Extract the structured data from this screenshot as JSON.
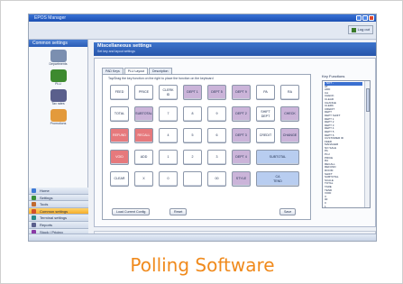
{
  "window": {
    "title": "EPOS Manager"
  },
  "header": {
    "logout_label": "Log out"
  },
  "sidebar": {
    "section_title": "Common settings",
    "icons": [
      {
        "label": "Departments",
        "icon": "cash-register-icon",
        "color": "#7b8fb0"
      },
      {
        "label": "PLU",
        "icon": "shapes-icon",
        "color": "#3d8a2f"
      },
      {
        "label": "Tax rates",
        "icon": "percent-icon",
        "color": "#5a5f8c"
      },
      {
        "label": "Promotions",
        "icon": "tag-icon",
        "color": "#e39a3b"
      }
    ],
    "nav": [
      {
        "label": "Home",
        "color": "#3f7ad6"
      },
      {
        "label": "Settings",
        "color": "#3b8f3b"
      },
      {
        "label": "Tools",
        "color": "#c06a30"
      },
      {
        "label": "Common settings",
        "color": "#d24f2a",
        "selected": true
      },
      {
        "label": "Terminal settings",
        "color": "#2a8a8a"
      },
      {
        "label": "Reports",
        "color": "#5a5f8c"
      },
      {
        "label": "Stock / Pricing",
        "color": "#8a3aa6"
      },
      {
        "label": "Exports",
        "color": "#3f7ad6"
      }
    ]
  },
  "main": {
    "title": "Miscellaneous settings",
    "subtitle": "Set key and layout settings",
    "tabs": [
      "PAD Keys",
      "PLU Layout",
      "Description"
    ],
    "active_tab": 1,
    "instruction": "Tap/Drag the key function on the right to place the function on the keyboard",
    "keys": [
      {
        "label": "FEED",
        "color": "white"
      },
      {
        "label": "PRICE",
        "color": "white"
      },
      {
        "label": "CLERK\nID",
        "color": "white"
      },
      {
        "label": "DEPT 1",
        "color": "purple"
      },
      {
        "label": "DEPT 5",
        "color": "purple"
      },
      {
        "label": "DEPT 9",
        "color": "purple"
      },
      {
        "label": "PA",
        "color": "white"
      },
      {
        "label": "RA",
        "color": "white"
      },
      {
        "label": "TOTAL",
        "color": "white"
      },
      {
        "label": "SUBTOTAL",
        "color": "purple"
      },
      {
        "label": "7",
        "color": "white"
      },
      {
        "label": "8",
        "color": "white"
      },
      {
        "label": "9",
        "color": "white"
      },
      {
        "label": "DEPT 2",
        "color": "purple"
      },
      {
        "label": "SHIFT\nDEPT",
        "color": "white"
      },
      {
        "label": "CHECK",
        "color": "purple"
      },
      {
        "label": "REFUND",
        "color": "red"
      },
      {
        "label": "RECALL",
        "color": "red"
      },
      {
        "label": "4",
        "color": "white"
      },
      {
        "label": "5",
        "color": "white"
      },
      {
        "label": "6",
        "color": "white"
      },
      {
        "label": "DEPT 3",
        "color": "purple"
      },
      {
        "label": "CREDIT",
        "color": "white"
      },
      {
        "label": "CHANGE",
        "color": "purple"
      },
      {
        "label": "VOID",
        "color": "red"
      },
      {
        "label": "ADD",
        "color": "white"
      },
      {
        "label": "1",
        "color": "white"
      },
      {
        "label": "2",
        "color": "white"
      },
      {
        "label": "3",
        "color": "white"
      },
      {
        "label": "DEPT 4",
        "color": "purple"
      },
      {
        "label": "SUBTOTAL",
        "color": "blue",
        "span": 2
      },
      {
        "label": "CLEAR",
        "color": "white"
      },
      {
        "label": "X",
        "color": "white"
      },
      {
        "label": "0",
        "color": "white"
      },
      {
        "label": "",
        "color": "white"
      },
      {
        "label": "00",
        "color": "white"
      },
      {
        "label": "STYLE",
        "color": "purple"
      },
      {
        "label": "CA\nTEND",
        "color": "blue",
        "span": 2
      }
    ],
    "buttons": {
      "load": "Load Current Config",
      "reset": "Reset",
      "save": "Save"
    },
    "functions": {
      "title": "Key Functions",
      "items": [
        "- NOT -",
        "AT",
        "ADD",
        "CA",
        "CHECK",
        "CLEAR",
        "CHANGE",
        "CLERK",
        "CREDIT",
        "DEPT",
        "DEPT SHIFT",
        "DEPT 1",
        "DEPT 2",
        "DEPT 3",
        "DEPT 4",
        "DEPT 5",
        "DEPT 6",
        "CUSTOMER ID",
        "FEED",
        "MANAGER",
        "NO SALE",
        "PA",
        "PLU",
        "PRICE",
        "RA",
        "RECALL",
        "REFUND",
        "ROOM",
        "SHIFT",
        "SUBTOTAL",
        "SCALE",
        "TOTAL",
        "TARE",
        "TEND",
        "VOID",
        "X",
        "00",
        "0",
        "1",
        "2",
        "3",
        "4",
        "5",
        "6",
        "7",
        "8",
        "9"
      ],
      "selected_index": 0
    }
  },
  "caption": "Polling Software"
}
